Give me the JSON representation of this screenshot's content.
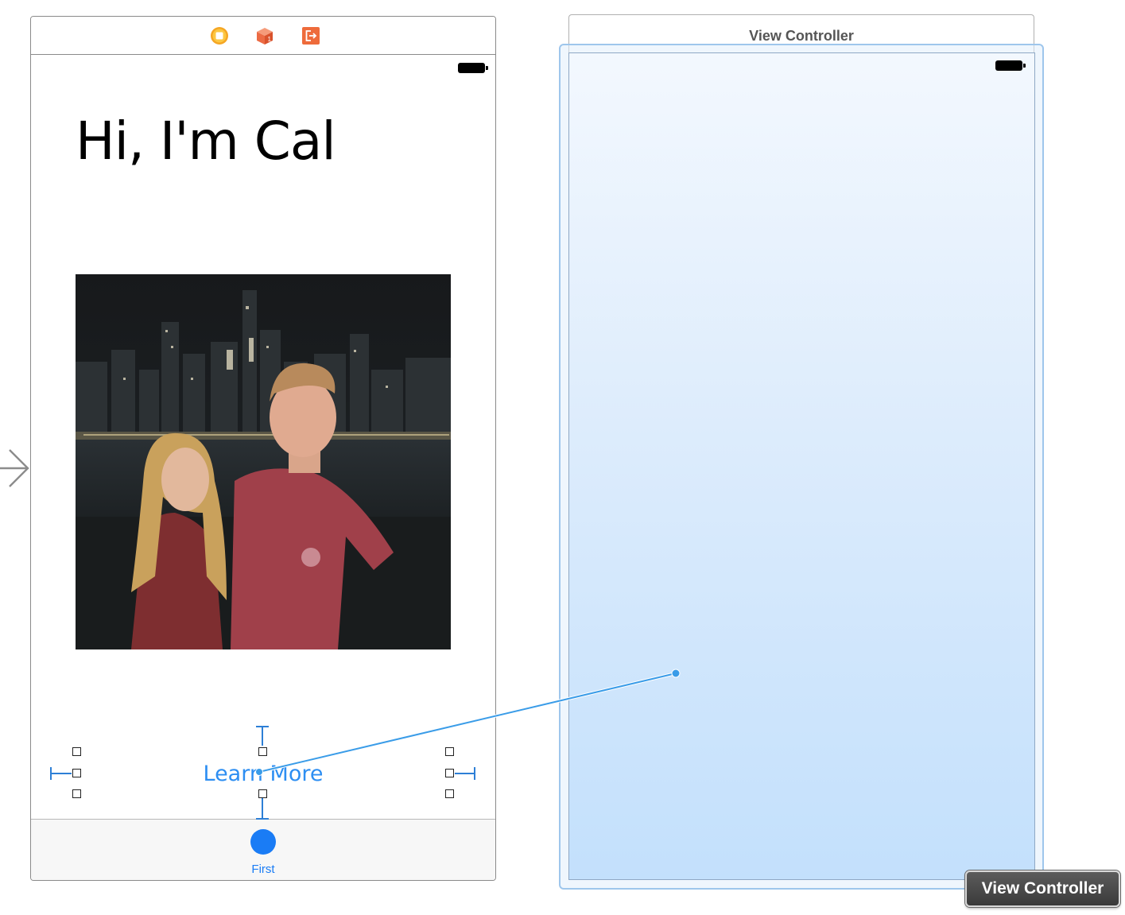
{
  "left_scene": {
    "dock_icons": [
      "first-responder-icon",
      "view-controller-cube-icon",
      "exit-icon"
    ],
    "title_label": "Hi, I'm Cal",
    "photo": "photo-couple-city-skyline-night",
    "button": {
      "label": "Learn More"
    },
    "tab_bar": {
      "items": [
        {
          "label": "First",
          "icon": "circle-icon"
        }
      ]
    }
  },
  "right_scene": {
    "title": "View Controller",
    "badge": "View Controller"
  },
  "entry_arrow": "chevron-right-icon",
  "colors": {
    "link_blue": "#2d8ef2",
    "tab_blue": "#1a7cf5",
    "connection_line": "#3a9ce8",
    "selection_blue": "#9ec6ec"
  }
}
